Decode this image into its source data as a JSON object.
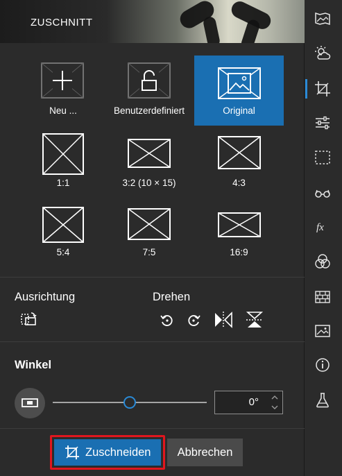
{
  "header": {
    "title": "ZUSCHNITT"
  },
  "ratios": [
    {
      "label": "Neu ...",
      "icon": "plus-icon"
    },
    {
      "label": "Benutzerdefiniert",
      "icon": "unlock-icon"
    },
    {
      "label": "Original",
      "icon": "image-icon",
      "selected": true
    },
    {
      "label": "1:1"
    },
    {
      "label": "3:2 (10 × 15)"
    },
    {
      "label": "4:3"
    },
    {
      "label": "5:4"
    },
    {
      "label": "7:5"
    },
    {
      "label": "16:9"
    }
  ],
  "orientation": {
    "label": "Ausrichtung"
  },
  "rotate": {
    "label": "Drehen"
  },
  "angle": {
    "label": "Winkel",
    "value": "0°",
    "slider_fraction": 0.5
  },
  "actions": {
    "crop_label": "Zuschneiden",
    "cancel_label": "Abbrechen"
  },
  "rail": [
    "picture-frame-icon",
    "weather-icon",
    "crop-icon",
    "sliders-icon",
    "selection-icon",
    "glasses-icon",
    "fx-icon",
    "color-circles-icon",
    "brick-wall-icon",
    "image-icon",
    "info-icon",
    "flask-icon"
  ],
  "colors": {
    "accent": "#1a6fb2",
    "highlight": "#e0161e"
  }
}
